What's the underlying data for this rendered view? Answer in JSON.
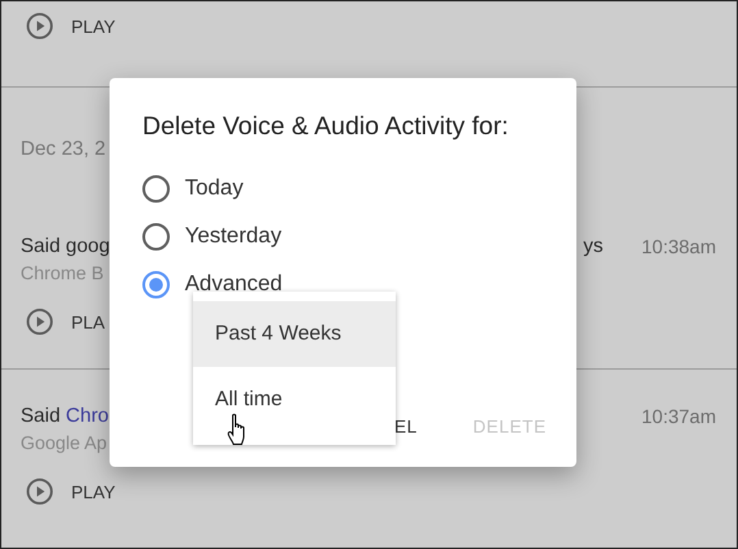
{
  "activity": {
    "top_play": "PLAY",
    "date": "Dec 23, 2",
    "items": [
      {
        "title": "Said goog",
        "title_end": "ys",
        "source": "Chrome B",
        "time": "10:38am",
        "play": "PLA"
      },
      {
        "title": "Said",
        "link": "Chro",
        "source": "Google Ap",
        "time": "10:37am",
        "play": "PLAY"
      }
    ]
  },
  "dialog": {
    "title": "Delete Voice & Audio Activity for:",
    "options": [
      {
        "label": "Today",
        "selected": false
      },
      {
        "label": "Yesterday",
        "selected": false
      },
      {
        "label": "Advanced",
        "selected": true
      }
    ],
    "menu": [
      {
        "label": "Past 4 Weeks",
        "highlighted": true
      },
      {
        "label": "All time",
        "highlighted": false
      }
    ],
    "buttons": [
      {
        "label": "EL",
        "disabled": false
      },
      {
        "label": "DELETE",
        "disabled": true
      }
    ]
  }
}
